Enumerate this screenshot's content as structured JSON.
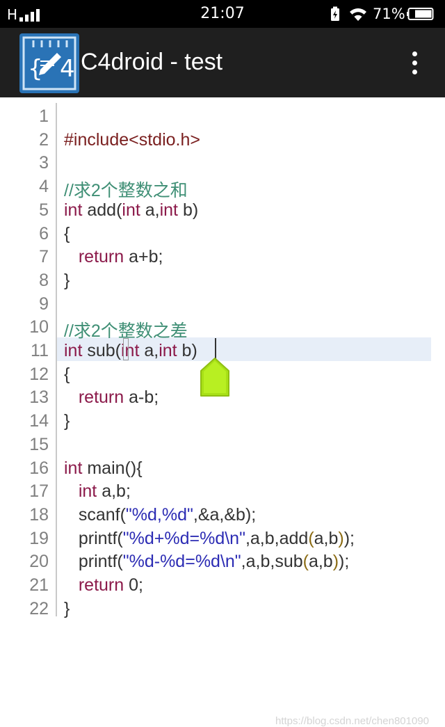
{
  "status_bar": {
    "carrier": "H",
    "time": "21:07",
    "battery": "71%"
  },
  "app_bar": {
    "title": "C4droid - test",
    "logo_icon": "c4droid-notepad-icon",
    "menu_icon": "more-vert-icon"
  },
  "editor": {
    "current_line": 11,
    "lines": [
      {
        "n": "1",
        "segs": []
      },
      {
        "n": "2",
        "segs": [
          {
            "t": "#include<stdio.h>",
            "c": "pp"
          }
        ]
      },
      {
        "n": "3",
        "segs": []
      },
      {
        "n": "4",
        "segs": [
          {
            "t": "//求2个整数之和",
            "c": "cm"
          }
        ]
      },
      {
        "n": "5",
        "segs": [
          {
            "t": "int",
            "c": "kw"
          },
          {
            "t": " add(",
            "c": ""
          },
          {
            "t": "int",
            "c": "kw"
          },
          {
            "t": " a,",
            "c": ""
          },
          {
            "t": "int",
            "c": "kw"
          },
          {
            "t": " b)",
            "c": ""
          }
        ]
      },
      {
        "n": "6",
        "segs": [
          {
            "t": "{",
            "c": ""
          }
        ]
      },
      {
        "n": "7",
        "segs": [
          {
            "t": "   ",
            "c": ""
          },
          {
            "t": "return",
            "c": "kw"
          },
          {
            "t": " a+b;",
            "c": ""
          }
        ]
      },
      {
        "n": "8",
        "segs": [
          {
            "t": "}",
            "c": ""
          }
        ]
      },
      {
        "n": "9",
        "segs": []
      },
      {
        "n": "10",
        "segs": [
          {
            "t": "//求2个整数之差",
            "c": "cm"
          }
        ]
      },
      {
        "n": "11",
        "segs": [
          {
            "t": "int",
            "c": "kw"
          },
          {
            "t": " sub(",
            "c": ""
          },
          {
            "t": "int",
            "c": "kw"
          },
          {
            "t": " a,",
            "c": ""
          },
          {
            "t": "int",
            "c": "kw"
          },
          {
            "t": " b)",
            "c": ""
          }
        ]
      },
      {
        "n": "12",
        "segs": [
          {
            "t": "{",
            "c": ""
          }
        ]
      },
      {
        "n": "13",
        "segs": [
          {
            "t": "   ",
            "c": ""
          },
          {
            "t": "return",
            "c": "kw"
          },
          {
            "t": " a-b;",
            "c": ""
          }
        ]
      },
      {
        "n": "14",
        "segs": [
          {
            "t": "}",
            "c": ""
          }
        ]
      },
      {
        "n": "15",
        "segs": []
      },
      {
        "n": "16",
        "segs": [
          {
            "t": "int",
            "c": "kw"
          },
          {
            "t": " main(){",
            "c": ""
          }
        ]
      },
      {
        "n": "17",
        "segs": [
          {
            "t": "   ",
            "c": ""
          },
          {
            "t": "int",
            "c": "kw"
          },
          {
            "t": " a,b;",
            "c": ""
          }
        ]
      },
      {
        "n": "18",
        "segs": [
          {
            "t": "   scanf(",
            "c": ""
          },
          {
            "t": "\"%d,%d\"",
            "c": "st"
          },
          {
            "t": ",&a,&b);",
            "c": ""
          }
        ]
      },
      {
        "n": "19",
        "segs": [
          {
            "t": "   printf(",
            "c": ""
          },
          {
            "t": "\"%d+%d=%d\\n\"",
            "c": "st"
          },
          {
            "t": ",a,b,add",
            "c": ""
          },
          {
            "t": "(",
            "c": "par"
          },
          {
            "t": "a,b",
            "c": ""
          },
          {
            "t": ")",
            "c": "par"
          },
          {
            "t": ");",
            "c": ""
          }
        ]
      },
      {
        "n": "20",
        "segs": [
          {
            "t": "   printf(",
            "c": ""
          },
          {
            "t": "\"%d-%d=%d\\n\"",
            "c": "st"
          },
          {
            "t": ",a,b,sub",
            "c": ""
          },
          {
            "t": "(",
            "c": "par"
          },
          {
            "t": "a,b",
            "c": ""
          },
          {
            "t": ")",
            "c": "par"
          },
          {
            "t": ");",
            "c": ""
          }
        ]
      },
      {
        "n": "21",
        "segs": [
          {
            "t": "   ",
            "c": ""
          },
          {
            "t": "return",
            "c": "kw"
          },
          {
            "t": " 0;",
            "c": ""
          }
        ]
      },
      {
        "n": "22",
        "segs": [
          {
            "t": "}",
            "c": ""
          }
        ]
      }
    ]
  },
  "watermark": "https://blog.csdn.net/chen801090",
  "colors": {
    "keyword": "#8b1a4a",
    "comment": "#3f8f75",
    "string": "#2c2cb4",
    "preprocessor": "#7a1f1f",
    "current_line_bg": "#e7eef8",
    "cursor_handle": "#a8e017"
  }
}
